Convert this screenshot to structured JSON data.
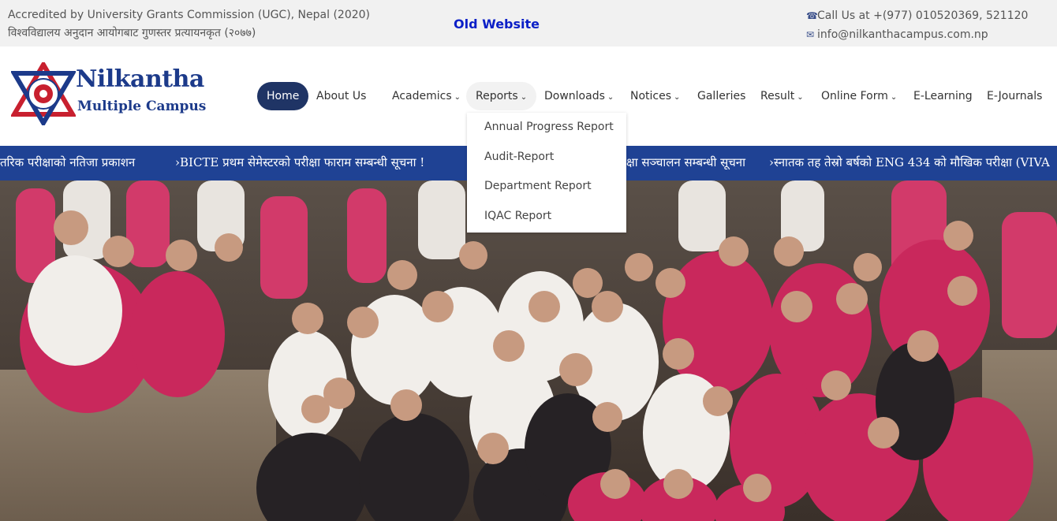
{
  "topbar": {
    "accreditation_en": "Accredited by University Grants Commission (UGC), Nepal (2020)",
    "accreditation_np": "विश्वविद्यालय अनुदान आयोगबाट गुणस्तर प्रत्यायनकृत (२०७७)",
    "old_website": "Old Website",
    "phone": "Call Us at +(977) 010520369, 521120",
    "email": "info@nilkanthacampus.com.np",
    "phone_icon": "☎",
    "email_icon": "✉"
  },
  "logo": {
    "line1": "Nilkantha",
    "line2": "Multiple Campus"
  },
  "nav": {
    "home": "Home",
    "about": "About Us",
    "academics": "Academics",
    "reports": "Reports",
    "downloads": "Downloads",
    "notices": "Notices",
    "galleries": "Galleries",
    "result": "Result",
    "online_form": "Online Form",
    "elearning": "E-Learning",
    "ejournals": "E-Journals",
    "caret": "⌄"
  },
  "reports_menu": {
    "items": [
      "Annual Progress Report",
      "Audit-Report",
      "Department Report",
      "IQAC Report"
    ]
  },
  "ticker": {
    "items": [
      "तरिक परीक्षाको नतिजा प्रकाशन",
      "›BICTE प्रथम सेमेस्टरको परीक्षा फाराम सम्बन्धी सूचना !",
      "क्षा सञ्चालन सम्बन्धी सूचना",
      "›स्नातक तह तेस्रो बर्षको ENG 434 को मौखिक परीक्षा (VIVA"
    ]
  },
  "colors": {
    "brand": "#1f3465",
    "ticker_bg": "#1f4294",
    "old_website": "#0b1fc7"
  }
}
